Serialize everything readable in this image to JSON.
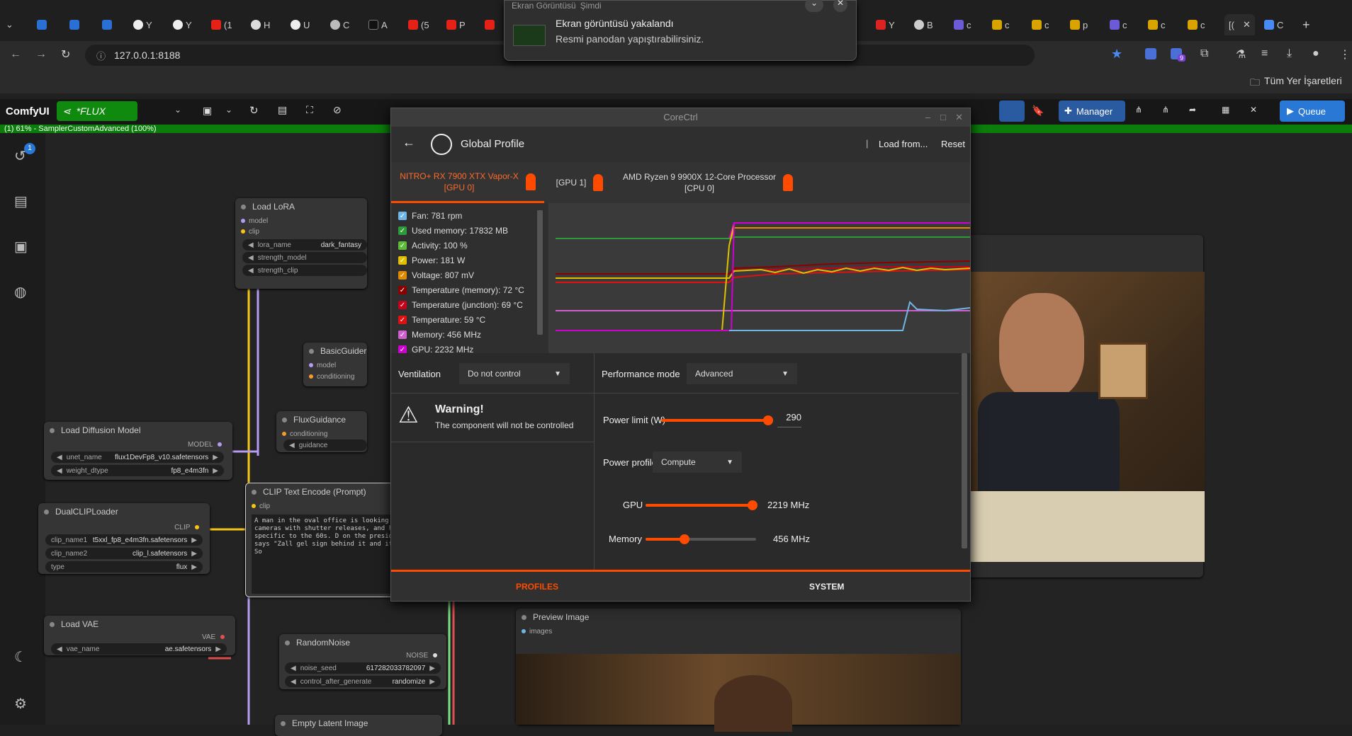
{
  "browser": {
    "tabs": [
      "Y",
      "Y",
      "(1",
      "H",
      "U",
      "C",
      "A",
      "(5",
      "P"
    ],
    "tabs_right": [
      "Y",
      "B",
      "c",
      "c",
      "c",
      "p",
      "c",
      "c",
      "c",
      "[(",
      "C"
    ],
    "address": "127.0.0.1:8188",
    "bookmarks_label": "Tüm Yer İşaretleri",
    "ext_badge": "9"
  },
  "notification": {
    "app": "Ekran Görüntüsü",
    "time": "Şimdi",
    "title": "Ekran görüntüsü yakalandı",
    "body": "Resmi panodan yapıştırabilirsiniz."
  },
  "comfy": {
    "brand": "ComfyUI",
    "workflow": "*FLUX",
    "manager_label": "Manager",
    "queue_label": "Queue",
    "progress_text": "(1) 61% - SamplerCustomAdvanced (100%)",
    "queue_badge": "1",
    "nodes": {
      "lora": {
        "title": "Load LoRA",
        "in1": "model",
        "in2": "clip",
        "w1_name": "lora_name",
        "w1_val": "dark_fantasy",
        "w2_name": "strength_model",
        "w3_name": "strength_clip"
      },
      "guider": {
        "title": "BasicGuider",
        "in1": "model",
        "in2": "conditioning"
      },
      "flux": {
        "title": "FluxGuidance",
        "in1": "conditioning",
        "w1_name": "guidance"
      },
      "diff": {
        "title": "Load Diffusion Model",
        "out": "MODEL",
        "w1_name": "unet_name",
        "w1_val": "flux1DevFp8_v10.safetensors",
        "w2_name": "weight_dtype",
        "w2_val": "fp8_e4m3fn"
      },
      "dual": {
        "title": "DualCLIPLoader",
        "out": "CLIP",
        "w1_name": "clip_name1",
        "w1_val": "t5xxl_fp8_e4m3fn.safetensors",
        "w2_name": "clip_name2",
        "w2_val": "clip_l.safetensors",
        "w3_name": "type",
        "w3_val": "flux"
      },
      "clip": {
        "title": "CLIP Text Encode (Prompt)",
        "in1": "clip",
        "text": "A man in the oval office is looking at phones, cameras with shutter releases, and hairstyles specific to the 60s. D on the president's desk says \"Zall gel sign behind it and it says \"Uludag So"
      },
      "vae": {
        "title": "Load VAE",
        "out": "VAE",
        "w1_name": "vae_name",
        "w1_val": "ae.safetensors"
      },
      "noise": {
        "title": "RandomNoise",
        "out": "NOISE",
        "w1_name": "noise_seed",
        "w1_val": "617282033782097",
        "w2_name": "control_after_generate",
        "w2_val": "randomize"
      },
      "latent": {
        "title": "Empty Latent Image"
      },
      "preview": {
        "title": "Preview Image",
        "in1": "images"
      }
    }
  },
  "corectrl": {
    "window_title": "CoreCtrl",
    "profile": "Global Profile",
    "load_from": "Load from...",
    "reset": "Reset",
    "tabs": [
      {
        "line1": "NITRO+ RX 7900 XTX Vapor-X",
        "line2": "[GPU 0]",
        "active": true
      },
      {
        "line1": "[GPU 1]",
        "line2": "",
        "active": false
      },
      {
        "line1": "AMD Ryzen 9 9900X 12-Core Processor",
        "line2": "[CPU 0]",
        "active": false
      }
    ],
    "sensors": [
      {
        "label": "Fan: 781 rpm",
        "color": "#6fb6e6"
      },
      {
        "label": "Used memory: 17832 MB",
        "color": "#2e9b3a"
      },
      {
        "label": "Activity: 100 %",
        "color": "#5dbb3a"
      },
      {
        "label": "Power: 181 W",
        "color": "#e0c000"
      },
      {
        "label": "Voltage: 807 mV",
        "color": "#e08a00"
      },
      {
        "label": "Temperature (memory): 72 °C",
        "color": "#8b0000"
      },
      {
        "label": "Temperature (junction): 69 °C",
        "color": "#c8001a"
      },
      {
        "label": "Temperature: 59 °C",
        "color": "#e01010"
      },
      {
        "label": "Memory: 456 MHz",
        "color": "#d060d0"
      },
      {
        "label": "GPU: 2232 MHz",
        "color": "#d000d0"
      }
    ],
    "ventilation_label": "Ventilation",
    "ventilation_value": "Do not control",
    "warning_title": "Warning!",
    "warning_text": "The component will not be controlled",
    "perf_label": "Performance mode",
    "perf_value": "Advanced",
    "power_limit_label": "Power limit (W)",
    "power_limit_value": "290",
    "power_profile_label": "Power profile",
    "power_profile_value": "Compute",
    "gpu_label": "GPU",
    "gpu_value": "2219 MHz",
    "mem_label": "Memory",
    "mem_value": "456 MHz",
    "footer_profiles": "PROFILES",
    "footer_system": "SYSTEM",
    "accent": "#ff4b00"
  }
}
